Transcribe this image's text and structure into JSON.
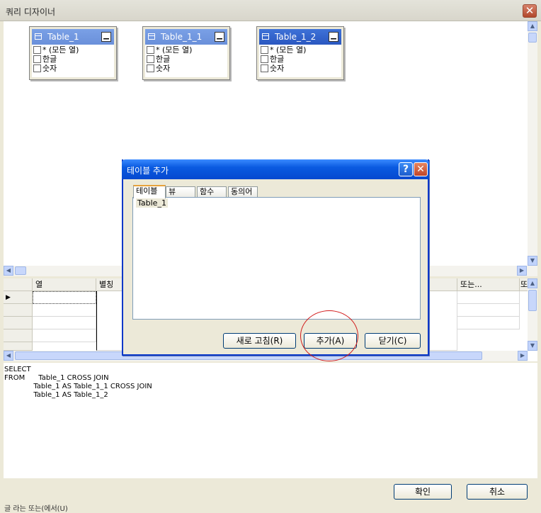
{
  "window": {
    "title": "쿼리 디자이너",
    "close_glyph": "✕"
  },
  "diagram": {
    "tables": [
      {
        "name": "Table_1",
        "columns": [
          "* (모든 열)",
          "한글",
          "숫자"
        ],
        "active": false
      },
      {
        "name": "Table_1_1",
        "columns": [
          "* (모든 열)",
          "한글",
          "숫자"
        ],
        "active": false
      },
      {
        "name": "Table_1_2",
        "columns": [
          "* (모든 열)",
          "한글",
          "숫자"
        ],
        "active": true
      }
    ],
    "minimize_glyph": "▁"
  },
  "grid": {
    "headers": [
      "열",
      "별칭",
      "또는...",
      "또"
    ],
    "current_row_marker": "▶"
  },
  "sql": {
    "lines": [
      "SELECT",
      "FROM      Table_1 CROSS JOIN",
      "             Table_1 AS Table_1_1 CROSS JOIN",
      "             Table_1 AS Table_1_2"
    ]
  },
  "buttons": {
    "ok": "확인",
    "cancel": "취소"
  },
  "dialog": {
    "title": "테이블 추가",
    "help_glyph": "?",
    "close_glyph": "✕",
    "tabs": [
      "테이블",
      "뷰",
      "함수",
      "동의어"
    ],
    "list_items": [
      "Table_1"
    ],
    "refresh_label": "새로 고침(R)",
    "add_label": "추가(A)",
    "close_label": "닫기(C)"
  },
  "status_text": "글 라는  또는(에서(U)",
  "scroll_glyphs": {
    "up": "▲",
    "down": "▼",
    "left": "◀",
    "right": "▶"
  },
  "colors": {
    "titlebar_active": "#0a5ae0",
    "table_header": "#2a57c0",
    "highlight_circle": "#d11a1a"
  }
}
